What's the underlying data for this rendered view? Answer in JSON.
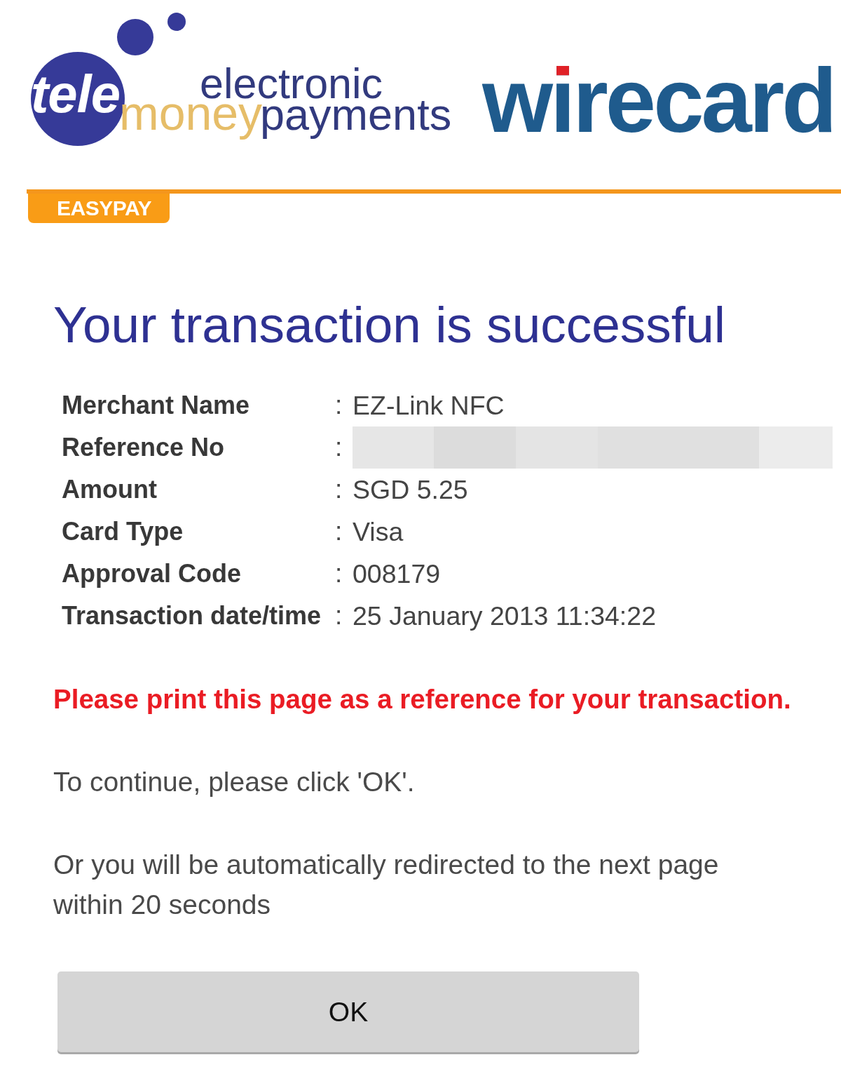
{
  "header": {
    "telemoney_logo": {
      "mark_text": "tele",
      "accent_text": "money",
      "line_1": "electronic",
      "line_2": "payments"
    },
    "wirecard_logo": {
      "text": "wirecard"
    }
  },
  "section_tab": {
    "label": "EASYPAY"
  },
  "title": "Your transaction is successful",
  "details": [
    {
      "label": "Merchant Name",
      "separator": ":",
      "value": "EZ-Link NFC",
      "redacted": false
    },
    {
      "label": "Reference No",
      "separator": ":",
      "redacted": true
    },
    {
      "label": "Amount",
      "separator": ":",
      "value": "SGD 5.25",
      "redacted": false
    },
    {
      "label": "Card Type",
      "separator": ":",
      "value": "Visa",
      "redacted": false
    },
    {
      "label": "Approval Code",
      "separator": ":",
      "value": "008179",
      "redacted": false
    },
    {
      "label": "Transaction date/time",
      "separator": ":",
      "value": "25 January 2013 11:34:22",
      "redacted": false
    }
  ],
  "notice": "Please print this page as a reference for your transaction.",
  "instructions": [
    "To continue, please click 'OK'.",
    "Or you will be automatically redirected to the next page within 20 seconds"
  ],
  "buttons": [
    {
      "label": "OK"
    }
  ]
}
